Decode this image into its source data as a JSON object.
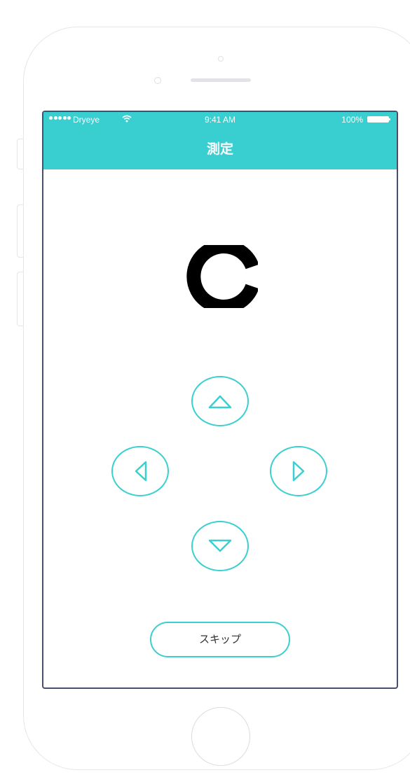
{
  "status_bar": {
    "carrier": "Dryeye",
    "time": "9:41 AM",
    "battery": "100%"
  },
  "nav": {
    "title": "測定"
  },
  "test": {
    "optotype": "landolt-c-icon",
    "gap_direction": "right"
  },
  "controls": {
    "up_icon": "triangle-up-icon",
    "left_icon": "triangle-left-icon",
    "right_icon": "triangle-right-icon",
    "down_icon": "triangle-down-icon"
  },
  "skip_button": {
    "label": "スキップ"
  },
  "colors": {
    "accent": "#39cfd0",
    "screen_border": "#4a4e6d",
    "optotype": "#000000"
  }
}
